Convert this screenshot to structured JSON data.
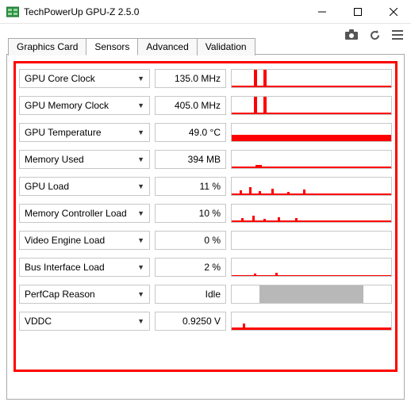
{
  "window": {
    "title": "TechPowerUp GPU-Z 2.5.0"
  },
  "tabs": [
    {
      "label": "Graphics Card"
    },
    {
      "label": "Sensors"
    },
    {
      "label": "Advanced"
    },
    {
      "label": "Validation"
    }
  ],
  "sensors": [
    {
      "label": "GPU Core Clock",
      "value": "135.0 MHz",
      "graph": "spikes"
    },
    {
      "label": "GPU Memory Clock",
      "value": "405.0 MHz",
      "graph": "spikes"
    },
    {
      "label": "GPU Temperature",
      "value": "49.0 °C",
      "graph": "thick"
    },
    {
      "label": "Memory Used",
      "value": "394 MB",
      "graph": "thin"
    },
    {
      "label": "GPU Load",
      "value": "11 %",
      "graph": "noisy"
    },
    {
      "label": "Memory Controller Load",
      "value": "10 %",
      "graph": "noisy"
    },
    {
      "label": "Video Engine Load",
      "value": "0 %",
      "graph": "empty"
    },
    {
      "label": "Bus Interface Load",
      "value": "2 %",
      "graph": "thin"
    },
    {
      "label": "PerfCap Reason",
      "value": "Idle",
      "graph": "grey"
    },
    {
      "label": "VDDC",
      "value": "0.9250 V",
      "graph": "thin-spike"
    }
  ]
}
